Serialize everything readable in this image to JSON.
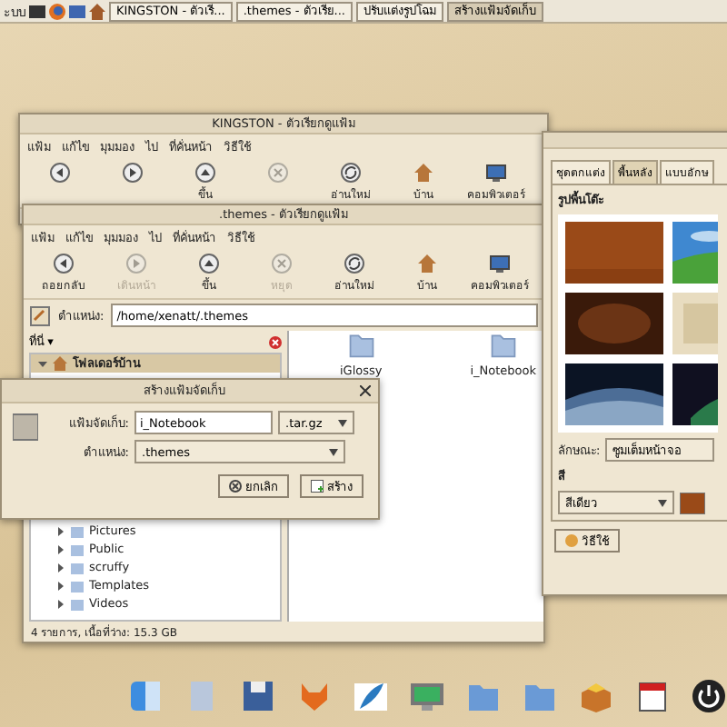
{
  "taskbar": {
    "menu_label": "ะบบ",
    "tasks": [
      {
        "label": "KINGSTON - ตัวเรี...",
        "selected": false
      },
      {
        "label": ".themes - ตัวเรีย...",
        "selected": false
      },
      {
        "label": "ปรับแต่งรูปโฉม",
        "selected": false
      },
      {
        "label": "สร้างแฟ้มจัดเก็บ",
        "selected": true
      }
    ]
  },
  "back_window": {
    "title": "KINGSTON - ตัวเรียกดูแฟ้ม",
    "menu": [
      "แฟ้ม",
      "แก้ไข",
      "มุมมอง",
      "ไป",
      "ที่คั่นหน้า",
      "วิธีใช้"
    ],
    "toolbar": [
      {
        "kind": "back",
        "disabled": false
      },
      {
        "kind": "forward",
        "disabled": false
      },
      {
        "kind": "up",
        "label": "ขึ้น",
        "disabled": false
      },
      {
        "kind": "stop",
        "disabled": true
      },
      {
        "kind": "reload",
        "label": "อ่านใหม่",
        "disabled": false
      },
      {
        "kind": "home",
        "label": "บ้าน",
        "disabled": false
      },
      {
        "kind": "computer",
        "label": "คอมพิวเตอร์",
        "disabled": false
      }
    ]
  },
  "file_window": {
    "title": ".themes - ตัวเรียกดูแฟ้ม",
    "menu": [
      "แฟ้ม",
      "แก้ไข",
      "มุมมอง",
      "ไป",
      "ที่คั่นหน้า",
      "วิธีใช้"
    ],
    "toolbar": [
      {
        "kind": "back",
        "label": "ถอยกลับ",
        "disabled": false
      },
      {
        "kind": "forward",
        "label": "เดินหน้า",
        "disabled": true
      },
      {
        "kind": "up",
        "label": "ขึ้น",
        "disabled": false
      },
      {
        "kind": "stop",
        "label": "หยุด",
        "disabled": true
      },
      {
        "kind": "reload",
        "label": "อ่านใหม่",
        "disabled": false
      },
      {
        "kind": "home",
        "label": "บ้าน",
        "disabled": false
      },
      {
        "kind": "computer",
        "label": "คอมพิวเตอร์",
        "disabled": false
      }
    ],
    "location_label": "ตำแหน่ง:",
    "location": "/home/xenatt/.themes",
    "sidebar_title": "ที่นี่ ▾",
    "tree": [
      {
        "label": "โฟลเดอร์บ้าน",
        "expanded": true,
        "selected": true,
        "children": [
          {
            "label": "Pictures",
            "expanded": false,
            "selected": false
          },
          {
            "label": "Public",
            "expanded": false,
            "selected": false
          },
          {
            "label": "scruffy",
            "expanded": false,
            "selected": false
          },
          {
            "label": "Templates",
            "expanded": false,
            "selected": false
          },
          {
            "label": "Videos",
            "expanded": false,
            "selected": false
          }
        ]
      }
    ],
    "files": [
      {
        "name": "iGlossy"
      },
      {
        "name": "i_Notebook"
      }
    ],
    "status": "4 รายการ, เนื้อที่ว่าง: 15.3 GB"
  },
  "dialog": {
    "title": "สร้างแฟ้มจัดเก็บ",
    "name_label": "แฟ้มจัดเก็บ:",
    "name_value": "i_Notebook",
    "extension": ".tar.gz",
    "location_label": "ตำแหน่ง:",
    "location": ".themes",
    "buttons": [
      {
        "kind": "cancel",
        "label": "ยกเลิก"
      },
      {
        "kind": "create",
        "label": "สร้าง"
      }
    ]
  },
  "appearance": {
    "tabs": [
      {
        "label": "ชุดตกแต่ง",
        "selected": false
      },
      {
        "label": "พื้นหลัง",
        "selected": true
      },
      {
        "label": "แบบอักษ",
        "selected": false
      }
    ],
    "wallpaper_label": "รูปพื้นโต๊ะ",
    "style_label": "ลักษณะ:",
    "style_value": "ซูมเต็มหน้าจอ",
    "color_label": "สี",
    "color_mode": "สีเดียว",
    "help_button": "วิธีใช้"
  }
}
